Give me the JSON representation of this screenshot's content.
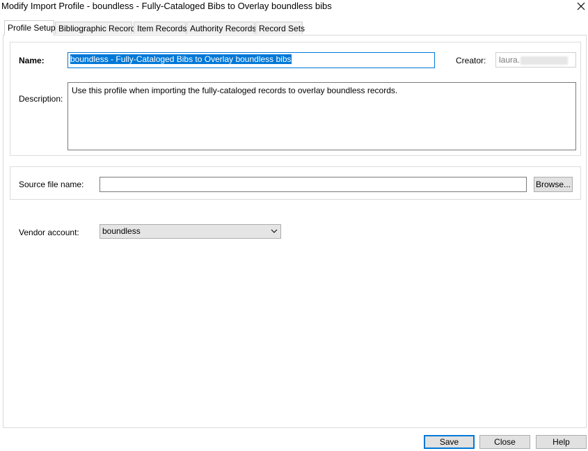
{
  "window": {
    "title": "Modify Import Profile - boundless - Fully-Cataloged Bibs to Overlay boundless bibs",
    "close_glyph": "✕"
  },
  "tabs": [
    {
      "label": "Profile Setup",
      "active": true
    },
    {
      "label": "Bibliographic Records"
    },
    {
      "label": "Item Records"
    },
    {
      "label": "Authority Records"
    },
    {
      "label": "Record Sets"
    }
  ],
  "profile": {
    "name_label": "Name:",
    "name_value": "boundless - Fully-Cataloged Bibs to Overlay boundless bibs",
    "creator_label": "Creator:",
    "creator_value": "laura.",
    "description_label": "Description:",
    "description_value": "Use this profile when importing the fully-cataloged records to overlay boundless records."
  },
  "source": {
    "label": "Source file name:",
    "value": "",
    "browse_label": "Browse..."
  },
  "vendor": {
    "label": "Vendor account:",
    "selected": "boundless"
  },
  "footer": {
    "save_label": "Save",
    "close_label": "Close",
    "help_label": "Help"
  }
}
